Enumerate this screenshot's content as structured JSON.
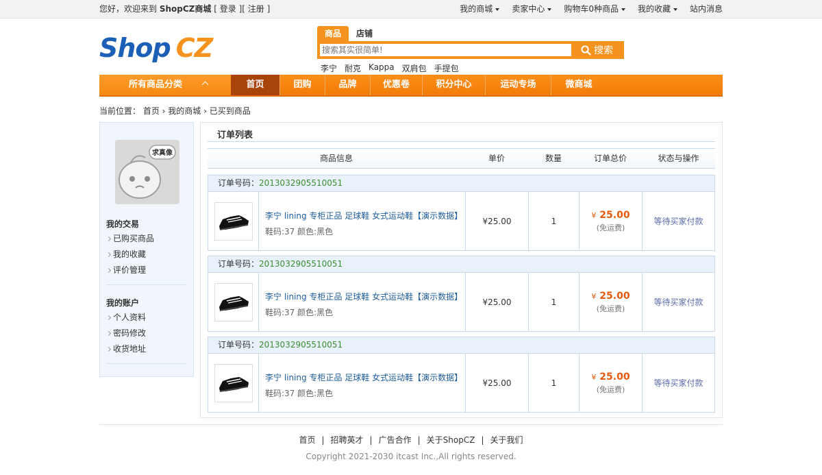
{
  "topbar": {
    "welcome": "您好，欢迎来到",
    "site_name": "ShopCZ商城",
    "login_open": "[",
    "login": "登录",
    "reg_sep": "][",
    "register": "注册",
    "close": "]",
    "links": [
      "我的商城",
      "卖家中心",
      "购物车0种商品",
      "我的收藏",
      "站内消息"
    ]
  },
  "logo": {
    "shop": "Shop",
    "cz": "CZ"
  },
  "search": {
    "tabs": [
      "商品",
      "店铺"
    ],
    "placeholder": "搜索其实很简单!",
    "button": "搜索",
    "hot": [
      "李宁",
      "耐克",
      "Kappa",
      "双肩包",
      "手提包"
    ]
  },
  "nav": {
    "all": "所有商品分类",
    "items": [
      "首页",
      "团购",
      "品牌",
      "优惠卷",
      "积分中心",
      "运动专场",
      "微商城"
    ]
  },
  "breadcrumb": {
    "prefix": "当前位置：",
    "items": [
      "首页",
      "我的商城",
      "已买到商品"
    ]
  },
  "sidebar": {
    "avatar_text": "求真像",
    "groups": [
      {
        "title": "我的交易",
        "items": [
          "已购买商品",
          "我的收藏",
          "评价管理"
        ]
      },
      {
        "title": "我的账户",
        "items": [
          "个人资料",
          "密码修改",
          "收货地址"
        ]
      }
    ]
  },
  "orders_panel": {
    "title": "订单列表",
    "columns": [
      "商品信息",
      "单价",
      "数量",
      "订单总价",
      "状态与操作"
    ],
    "order_label": "订单号码：",
    "orders": [
      {
        "number": "2013032905510051",
        "product": "李宁 lining 专柜正品 足球鞋 女式运动鞋【演示数据】",
        "attrs": "鞋码:37 颜色:黑色",
        "price": "¥25.00",
        "qty": "1",
        "total_symbol": "¥",
        "total": "25.00",
        "shipping": "(免运费)",
        "status": "等待买家付款"
      },
      {
        "number": "2013032905510051",
        "product": "李宁 lining 专柜正品 足球鞋 女式运动鞋【演示数据】",
        "attrs": "鞋码:37 颜色:黑色",
        "price": "¥25.00",
        "qty": "1",
        "total_symbol": "¥",
        "total": "25.00",
        "shipping": "(免运费)",
        "status": "等待买家付款"
      },
      {
        "number": "2013032905510051",
        "product": "李宁 lining 专柜正品 足球鞋 女式运动鞋【演示数据】",
        "attrs": "鞋码:37 颜色:黑色",
        "price": "¥25.00",
        "qty": "1",
        "total_symbol": "¥",
        "total": "25.00",
        "shipping": "(免运费)",
        "status": "等待买家付款"
      }
    ]
  },
  "footer": {
    "links": [
      "首页",
      "招聘英才",
      "广告合作",
      "关于ShopCZ",
      "关于我们"
    ],
    "copyright": "Copyright 2021-2030 itcast Inc.,All rights reserved."
  }
}
